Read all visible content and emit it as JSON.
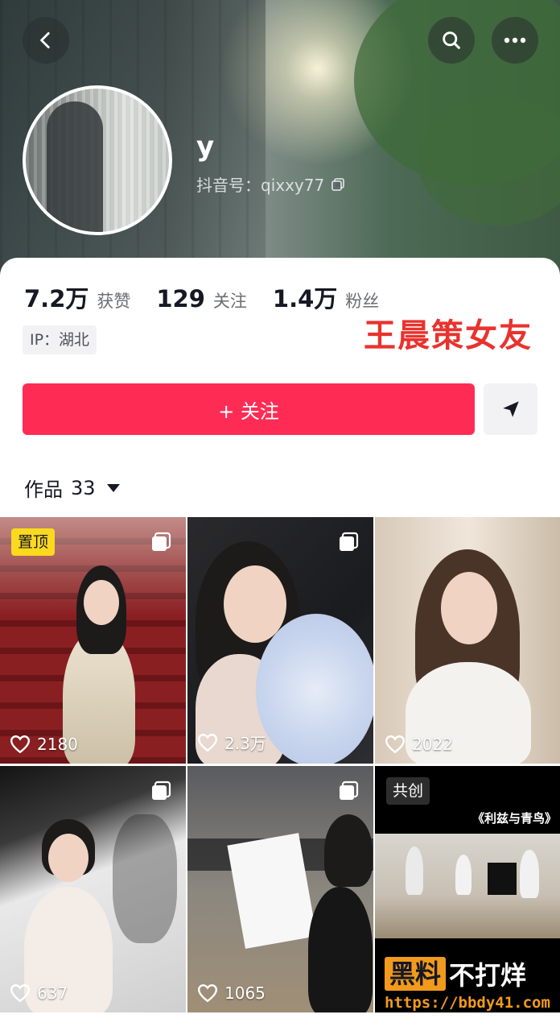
{
  "profile": {
    "username": "y",
    "douyin_id": "抖音号：qixxy77"
  },
  "stats": [
    {
      "value": "7.2万",
      "label": "获赞"
    },
    {
      "value": "129",
      "label": "关注"
    },
    {
      "value": "1.4万",
      "label": "粉丝"
    }
  ],
  "ip_location": "IP：湖北",
  "overlay_caption": "王晨策女友",
  "actions": {
    "follow_label": "+ 关注"
  },
  "works": {
    "label": "作品",
    "count": "33"
  },
  "videos": [
    {
      "likes": "2180",
      "badge": "置顶"
    },
    {
      "likes": "2.3万"
    },
    {
      "likes": "2022"
    },
    {
      "likes": "637"
    },
    {
      "likes": "1065"
    },
    {
      "likes": "",
      "badge": "共创",
      "caption": "《利兹与青鸟》"
    }
  ],
  "watermark": {
    "box": "黑料",
    "text": "不打烊",
    "url": "https://bbdy41.com"
  },
  "colors": {
    "accent": "#fe2c55",
    "pin_badge": "#fbd91e",
    "overlay_text": "#e8332e"
  },
  "icons": [
    "back-icon",
    "search-icon",
    "more-icon",
    "copy-icon",
    "share-send-icon",
    "dropdown-caret-icon",
    "heart-icon",
    "multi-image-icon"
  ]
}
